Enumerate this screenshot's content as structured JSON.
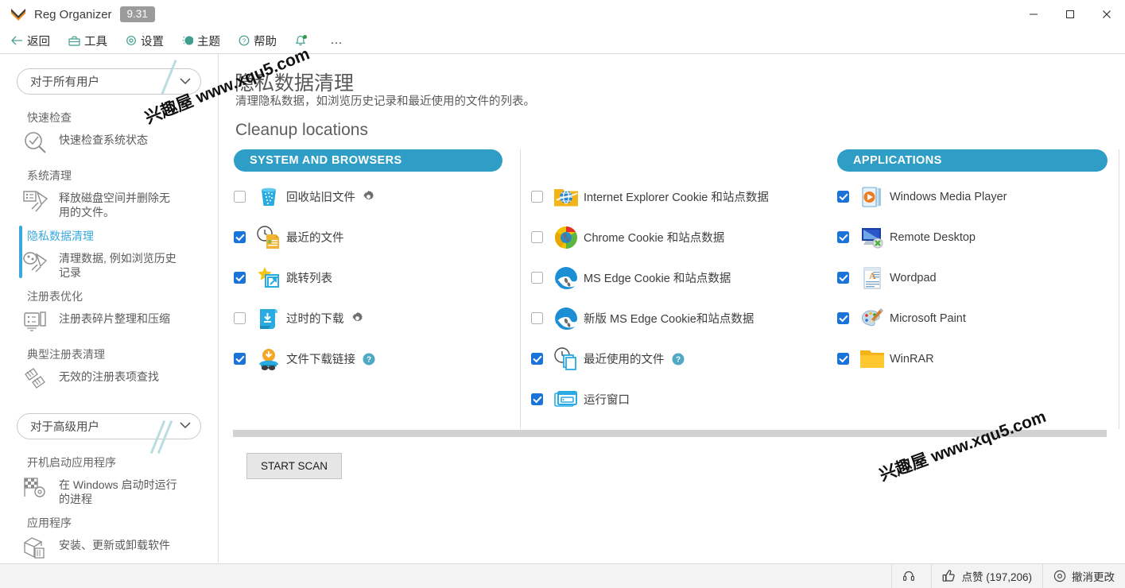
{
  "window": {
    "app_title": "Reg Organizer",
    "version_badge": "9.31",
    "controls": {
      "minimize": "–",
      "maximize": "□",
      "close": "✕"
    }
  },
  "menubar": {
    "items": [
      {
        "label": "返回",
        "icon": "back-arrow-icon"
      },
      {
        "label": "工具",
        "icon": "toolbox-icon"
      },
      {
        "label": "设置",
        "icon": "gear-icon"
      },
      {
        "label": "主题",
        "icon": "theme-icon"
      },
      {
        "label": "帮助",
        "icon": "help-circle-icon"
      }
    ],
    "notification_icon": "bell-icon",
    "overflow": "…"
  },
  "sidebar": {
    "select_all_users": {
      "value": "对于所有用户",
      "caret": "⌵"
    },
    "select_advanced_users": {
      "value": "对于高级用户",
      "caret": "⌵"
    },
    "group1": [
      {
        "title": "快速检查",
        "desc": "快速检查系统状态",
        "icon": "magnifier-check-icon",
        "active": false
      },
      {
        "title": "系统清理",
        "desc": "释放磁盘空间并删除无用的文件。",
        "icon": "broom-disk-icon",
        "active": false
      },
      {
        "title": "隐私数据清理",
        "desc": "清理数据, 例如浏览历史记录",
        "icon": "privacy-broom-icon",
        "active": true
      },
      {
        "title": "注册表优化",
        "desc": "注册表碎片整理和压缩",
        "icon": "registry-optimize-icon",
        "active": false
      },
      {
        "title": "典型注册表清理",
        "desc": "无效的注册表项查找",
        "icon": "registry-clean-icon",
        "active": false
      }
    ],
    "group2": [
      {
        "title": "开机启动应用程序",
        "desc": "在 Windows 启动时运行的进程",
        "icon": "startup-flag-icon",
        "active": false
      },
      {
        "title": "应用程序",
        "desc": "安装、更新或卸载软件",
        "icon": "package-icon",
        "active": false
      }
    ]
  },
  "main": {
    "page_title": "隐私数据清理",
    "page_subtitle": "清理隐私数据，如浏览历史记录和最近使用的文件的列表。",
    "section_title": "Cleanup locations",
    "columns": [
      {
        "header": "SYSTEM AND BROWSERS",
        "items": [
          {
            "label": "回收站旧文件",
            "checked": false,
            "icon": "recycle-bin-icon",
            "has_gear": true,
            "has_help": false
          },
          {
            "label": "最近的文件",
            "checked": true,
            "icon": "recent-files-icon",
            "has_gear": false,
            "has_help": false
          },
          {
            "label": "跳转列表",
            "checked": true,
            "icon": "jump-list-icon",
            "has_gear": false,
            "has_help": false
          },
          {
            "label": "过时的下载",
            "checked": false,
            "icon": "old-downloads-icon",
            "has_gear": true,
            "has_help": false
          },
          {
            "label": "文件下载链接",
            "checked": true,
            "icon": "download-link-icon",
            "has_gear": false,
            "has_help": true
          }
        ]
      },
      {
        "header": "",
        "items": [
          {
            "label": "Internet Explorer Cookie 和站点数据",
            "checked": false,
            "icon": "internet-explorer-icon",
            "has_gear": false,
            "has_help": false
          },
          {
            "label": "Chrome Cookie 和站点数据",
            "checked": false,
            "icon": "chrome-icon",
            "has_gear": false,
            "has_help": false
          },
          {
            "label": "MS Edge Cookie 和站点数据",
            "checked": false,
            "icon": "ms-edge-legacy-icon",
            "has_gear": false,
            "has_help": false
          },
          {
            "label": "新版 MS Edge Cookie和站点数据",
            "checked": false,
            "icon": "ms-edge-new-icon",
            "has_gear": false,
            "has_help": false
          },
          {
            "label": "最近使用的文件",
            "checked": true,
            "icon": "recent-used-files-icon",
            "has_gear": false,
            "has_help": true
          },
          {
            "label": "运行窗口",
            "checked": true,
            "icon": "run-dialog-icon",
            "has_gear": false,
            "has_help": false
          }
        ]
      },
      {
        "header": "APPLICATIONS",
        "items": [
          {
            "label": "Windows Media Player",
            "checked": true,
            "icon": "windows-media-player-icon",
            "has_gear": false,
            "has_help": false
          },
          {
            "label": "Remote Desktop",
            "checked": true,
            "icon": "remote-desktop-icon",
            "has_gear": false,
            "has_help": false
          },
          {
            "label": "Wordpad",
            "checked": true,
            "icon": "wordpad-icon",
            "has_gear": false,
            "has_help": false
          },
          {
            "label": "Microsoft Paint",
            "checked": true,
            "icon": "microsoft-paint-icon",
            "has_gear": false,
            "has_help": false
          },
          {
            "label": "WinRAR",
            "checked": true,
            "icon": "winrar-folder-icon",
            "has_gear": false,
            "has_help": false
          }
        ]
      }
    ],
    "start_scan_label": "START SCAN"
  },
  "statusbar": {
    "support": {
      "icon": "headset-icon",
      "label": ""
    },
    "like": {
      "icon": "thumbs-up-icon",
      "label": "点赞 (197,206)"
    },
    "undo": {
      "icon": "undo-circle-icon",
      "label": "撤消更改"
    }
  },
  "watermarks": [
    {
      "text": "兴趣屋 www.xqu5.com"
    },
    {
      "text": "兴趣屋 www.xqu5.com"
    }
  ],
  "colors": {
    "accent_blue": "#2f9ec6",
    "checkbox_blue": "#1a73d8",
    "active_item": "#39a9dc",
    "menu_icon_teal": "#3f9e8e"
  }
}
